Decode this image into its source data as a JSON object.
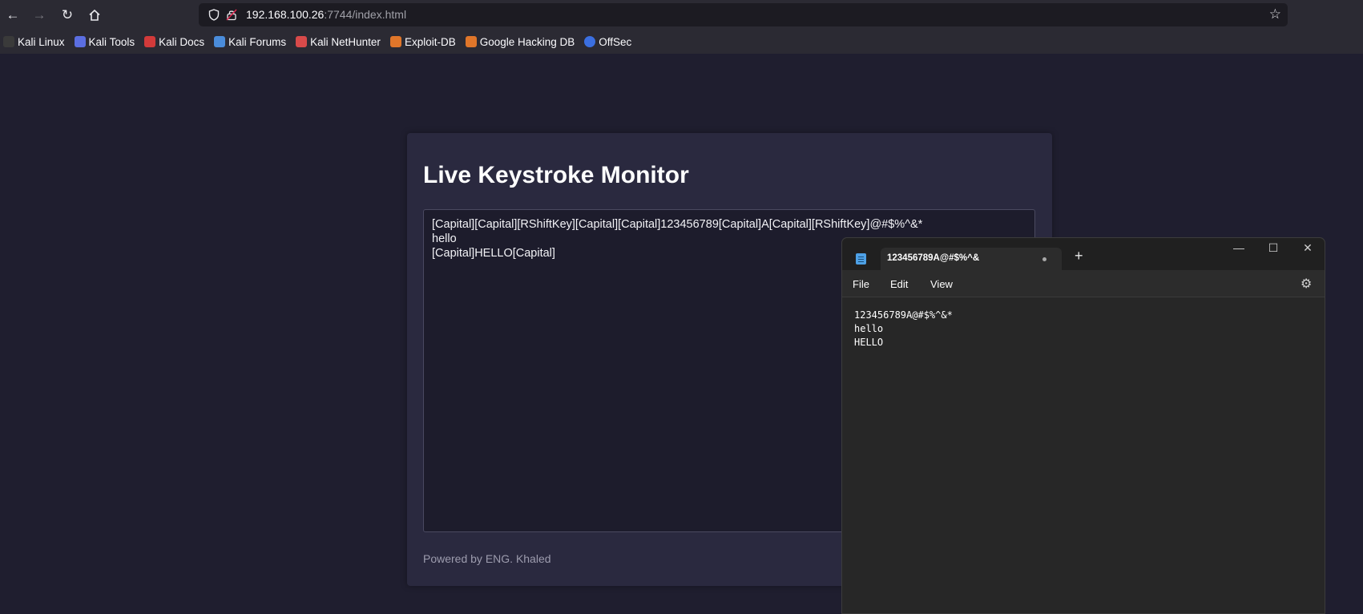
{
  "browser": {
    "url_host": "192.168.100.26",
    "url_rest": ":7744/index.html",
    "bookmarks": [
      {
        "label": "Kali Linux",
        "color": "#3a3a3a"
      },
      {
        "label": "Kali Tools",
        "color": "#5b6ee1"
      },
      {
        "label": "Kali Docs",
        "color": "#d23a3a"
      },
      {
        "label": "Kali Forums",
        "color": "#4a8cdb"
      },
      {
        "label": "Kali NetHunter",
        "color": "#d84a4a"
      },
      {
        "label": "Exploit-DB",
        "color": "#e0762a"
      },
      {
        "label": "Google Hacking DB",
        "color": "#e0762a"
      },
      {
        "label": "OffSec",
        "color": "#3b6fe0"
      }
    ]
  },
  "page": {
    "title": "Live Keystroke Monitor",
    "log": "[Capital][Capital][RShiftKey][Capital][Capital]123456789[Capital]A[Capital][RShiftKey]@#$%^&*\nhello\n[Capital]HELLO[Capital]",
    "footer": "Powered by ENG. Khaled"
  },
  "notepad": {
    "tab_title": "123456789A@#$%^&",
    "menu": {
      "file": "File",
      "edit": "Edit",
      "view": "View"
    },
    "content": "123456789A@#$%^&*\nhello\nHELLO"
  }
}
